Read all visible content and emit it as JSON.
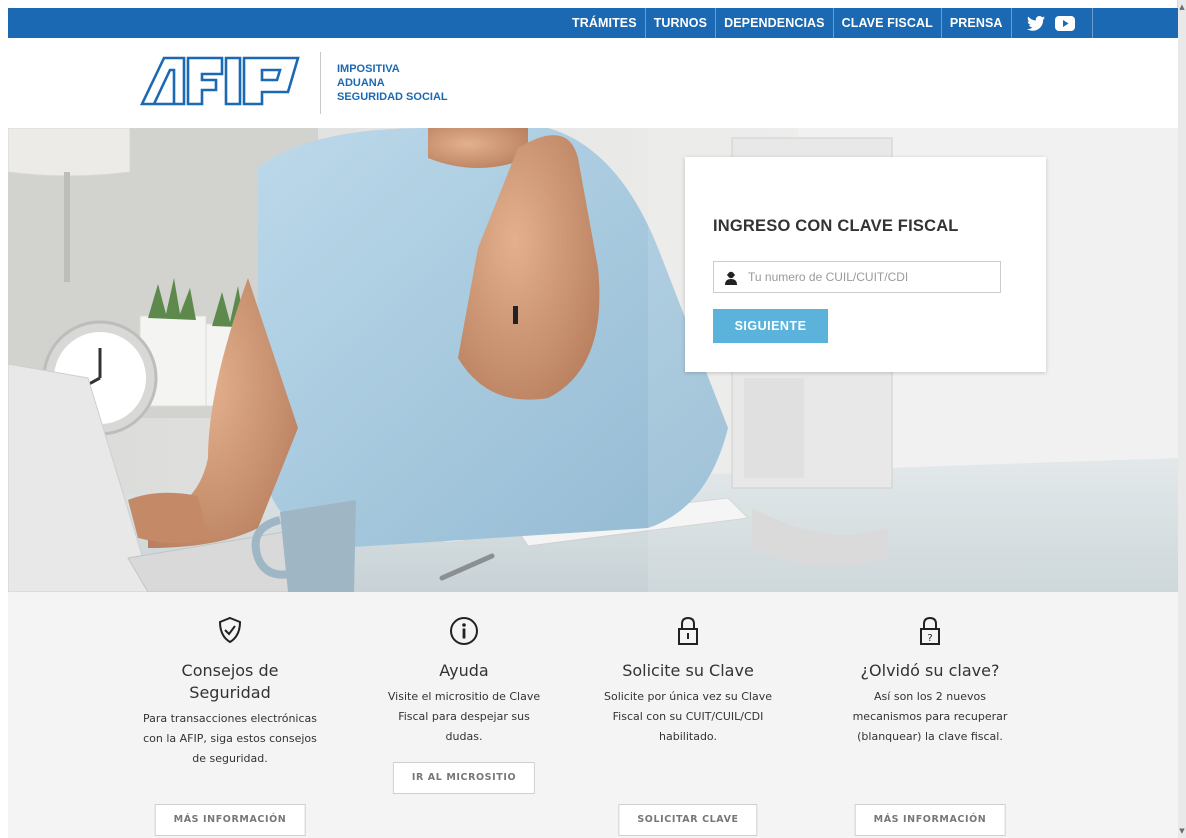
{
  "topnav": {
    "items": [
      {
        "label": "TRÁMITES"
      },
      {
        "label": "TURNOS"
      },
      {
        "label": "DEPENDENCIAS"
      },
      {
        "label": "CLAVE FISCAL"
      },
      {
        "label": "PRENSA"
      }
    ],
    "social": [
      "twitter-icon",
      "youtube-icon"
    ]
  },
  "header": {
    "logo_text": "AFIP",
    "lines": [
      "IMPOSITIVA",
      "ADUANA",
      "SEGURIDAD SOCIAL"
    ]
  },
  "login": {
    "title": "INGRESO CON CLAVE FISCAL",
    "input_placeholder": "Tu numero de CUIL/CUIT/CDI",
    "input_value": "",
    "button_label": "SIGUIENTE"
  },
  "features": [
    {
      "icon": "shield-check-icon",
      "title": "Consejos de Seguridad",
      "description": "Para transacciones electrónicas con la AFIP, siga estos consejos de seguridad.",
      "button_label": "MÁS INFORMACIÓN"
    },
    {
      "icon": "info-icon",
      "title": "Ayuda",
      "description": "Visite el micrositio de Clave Fiscal para despejar sus dudas.",
      "button_label": "IR AL MICROSITIO"
    },
    {
      "icon": "lock-icon",
      "title": "Solicite su Clave",
      "description": "Solicite por única vez su Clave Fiscal con su CUIT/CUIL/CDI habilitado.",
      "button_label": "SOLICITAR CLAVE"
    },
    {
      "icon": "lock-question-icon",
      "title": "¿Olvidó su clave?",
      "description": "Así son los 2 nuevos mecanismos para recuperar (blanquear) la clave fiscal.",
      "button_label": "MÁS INFORMACIÓN"
    }
  ],
  "colors": {
    "brand_blue": "#1b69b3",
    "button_blue": "#5bb3dc",
    "text_dark": "#333333"
  }
}
